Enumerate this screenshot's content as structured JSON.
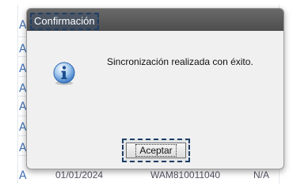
{
  "dialog": {
    "title": "Confirmación",
    "message": "Sincronización realizada con éxito.",
    "ok_label": "Aceptar",
    "icon": "info-icon"
  },
  "background": {
    "row_marker": "A",
    "bottom_row": [
      "01/01/2024",
      "WAM810011040",
      "N/A"
    ]
  },
  "colors": {
    "titlebar": "#5a5a5a",
    "dialog_bg": "#f0f0f0",
    "focus_dash": "#1f3f66"
  }
}
